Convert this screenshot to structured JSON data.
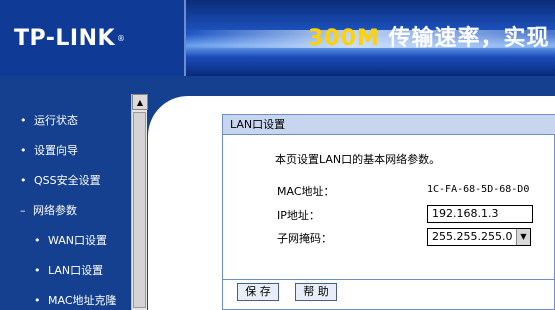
{
  "header": {
    "logo_text": "TP-LINK",
    "logo_reg": "®",
    "banner_highlight": "300M",
    "banner_rest": " 传输速率，实现",
    "colors": {
      "header_bg": "#1a3f92",
      "banner_highlight": "#ffd200"
    }
  },
  "sidebar": {
    "items": [
      {
        "label": "运行状态",
        "bullet": "•"
      },
      {
        "label": "设置向导",
        "bullet": "•"
      },
      {
        "label": "QSS安全设置",
        "bullet": "•"
      },
      {
        "label": "网络参数",
        "bullet": "–"
      },
      {
        "label": "WAN口设置",
        "bullet": "•"
      },
      {
        "label": "LAN口设置",
        "bullet": "•"
      },
      {
        "label": "MAC地址克隆",
        "bullet": "•"
      }
    ]
  },
  "panel": {
    "title": "LAN口设置",
    "description": "本页设置LAN口的基本网络参数。",
    "mac_label": "MAC地址：",
    "mac_value": "1C-FA-68-5D-68-D0",
    "ip_label": "IP地址：",
    "ip_value": "192.168.1.3",
    "mask_label": "子网掩码：",
    "mask_value": "255.255.255.0",
    "save_label": "保 存",
    "help_label": "帮 助"
  }
}
